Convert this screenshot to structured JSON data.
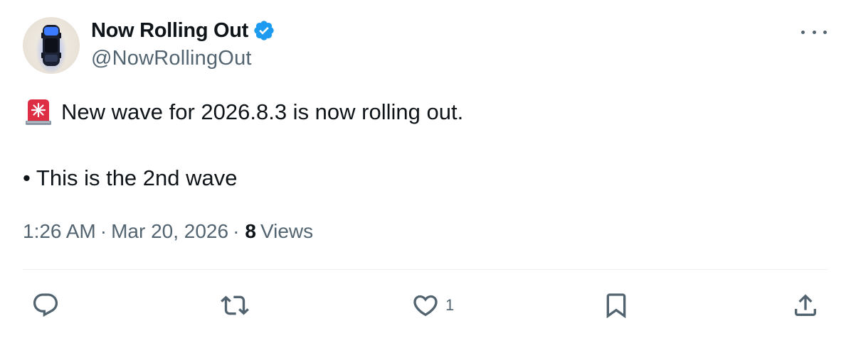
{
  "author": {
    "display_name": "Now Rolling Out",
    "handle": "@NowRollingOut",
    "verified": true,
    "verified_color": "#1d9bf0"
  },
  "tweet": {
    "line1_emoji": "rotating-light",
    "line1_text": "New wave for 2026.8.3 is now rolling out.",
    "line2_text": "• This is the 2nd wave"
  },
  "meta": {
    "time": "1:26 AM",
    "separator": "·",
    "date": "Mar 20, 2026",
    "views_count": "8",
    "views_label": "Views"
  },
  "actions": {
    "reply_icon": "reply-icon",
    "retweet_icon": "retweet-icon",
    "like_icon": "heart-icon",
    "like_count": "1",
    "bookmark_icon": "bookmark-icon",
    "share_icon": "share-icon"
  },
  "colors": {
    "text_primary": "#0f1419",
    "text_secondary": "#536471",
    "divider": "#eff3f4"
  }
}
